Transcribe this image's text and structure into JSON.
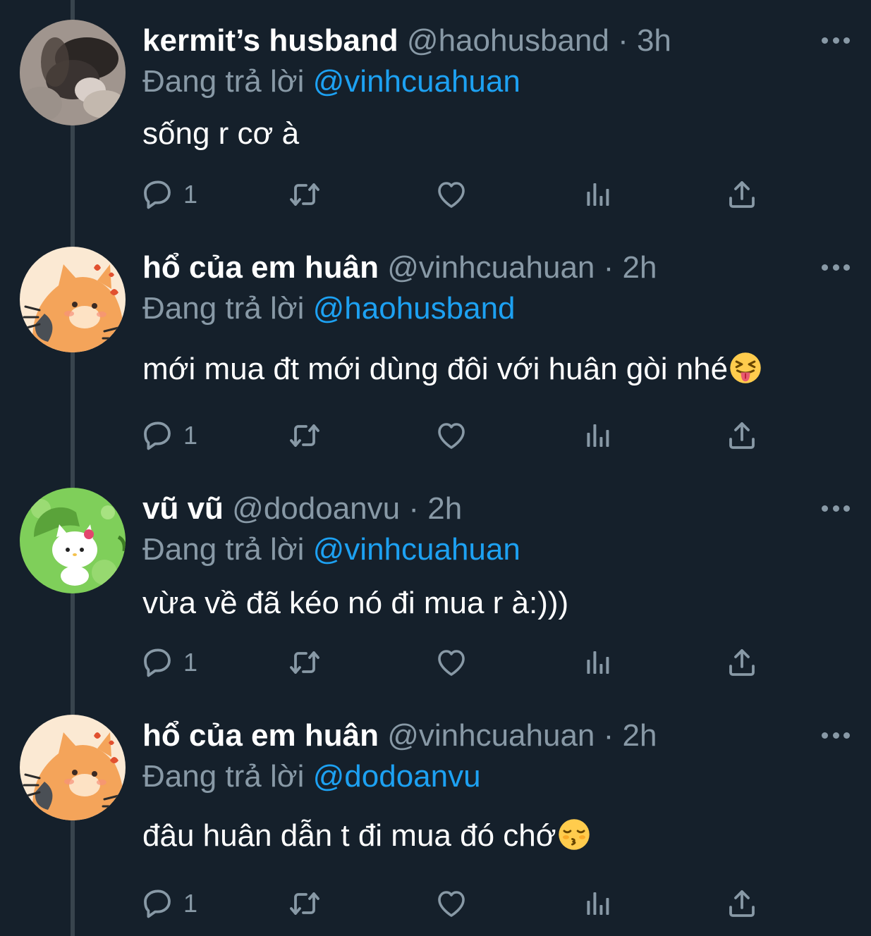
{
  "reply_prefix": "Đang trả lời",
  "tweets": [
    {
      "display_name": "kermit’s husband",
      "handle": "@haohusband",
      "separator": "·",
      "time": "3h",
      "reply_to": "@vinhcuahuan",
      "text": "sống r cơ à",
      "reply_count": "1",
      "avatar_icon": "avatar-blurry-photo"
    },
    {
      "display_name": "hổ của em huân",
      "handle": "@vinhcuahuan",
      "separator": "·",
      "time": "2h",
      "reply_to": "@haohusband",
      "text": "mới mua đt mới dùng đôi với huân gòi nhé",
      "text_emoji": "squinting-face-with-tongue",
      "reply_count": "1",
      "avatar_icon": "avatar-orange-cat"
    },
    {
      "display_name": "vũ vũ",
      "handle": "@dodoanvu",
      "separator": "·",
      "time": "2h",
      "reply_to": "@vinhcuahuan",
      "text": "vừa về đã kéo nó đi mua r à:)))",
      "reply_count": "1",
      "avatar_icon": "avatar-green-kitty"
    },
    {
      "display_name": "hổ của em huân",
      "handle": "@vinhcuahuan",
      "separator": "·",
      "time": "2h",
      "reply_to": "@dodoanvu",
      "text": "đâu huân dẫn t đi mua đó chớ",
      "text_emoji": "kissing-face-with-closed-eyes",
      "reply_count": "1",
      "avatar_icon": "avatar-orange-cat"
    }
  ],
  "colors": {
    "background": "#15202b",
    "primary_text": "#ffffff",
    "secondary_text": "#8899a6",
    "accent": "#1da1f2",
    "thread_line": "#38444d"
  }
}
